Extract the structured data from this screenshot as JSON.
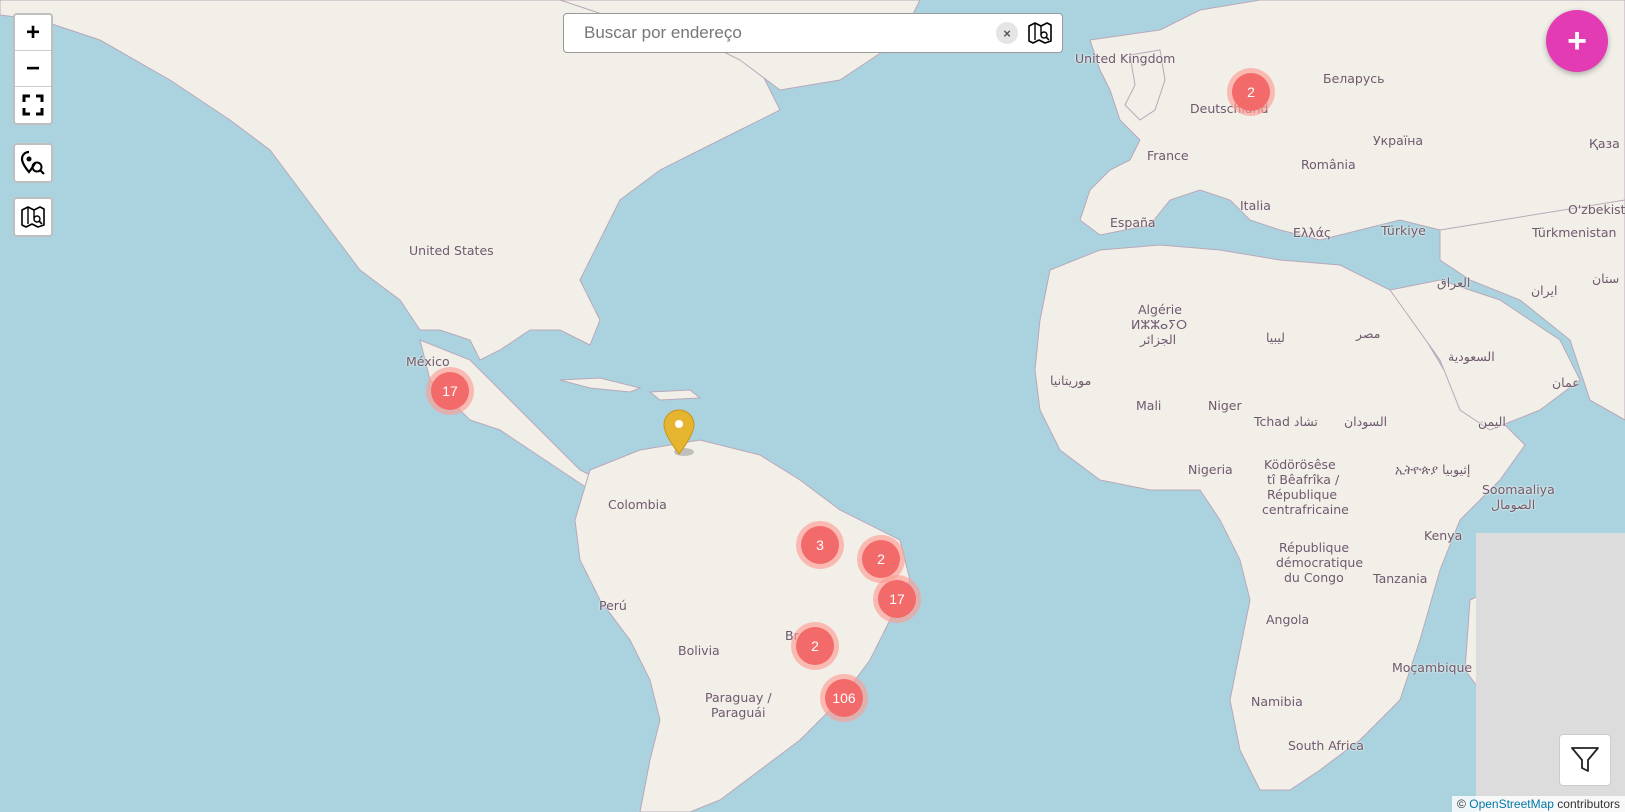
{
  "map": {
    "colors": {
      "water": "#aad3df",
      "land": "#f2efe9",
      "border": "#b9a8b9",
      "cluster_outer": "#fd9c94",
      "cluster_inner": "#f26a6a",
      "pin": "#e5b530",
      "fab": "#e23bb3"
    },
    "country_labels": [
      "United Kingdom",
      "Беларусь",
      "Deutschland",
      "Україна",
      "France",
      "România",
      "Қаза",
      "O'zbekist",
      "España",
      "Italia",
      "Ελλάς",
      "Türkiye",
      "Türkmenistan",
      "United States",
      "Algérie",
      "ⵍⵣⵣⴰⵢⵔ",
      "الجزائر",
      "ليبيا",
      "مصر",
      "العراق",
      "ايران",
      "ستان",
      "México",
      "موريتانيا",
      "Mali",
      "Niger",
      "Tchad تشاد",
      "السودان",
      "السعودية",
      "عمان",
      "اليمن",
      "Colombia",
      "Nigeria",
      "Ködörösêse",
      "tî Bêafrîka /",
      "République",
      "centrafricaine",
      "ኢትዮጵያ إثيوبيا",
      "Soomaaliya",
      "الصومال",
      "Kenya",
      "République",
      "démocratique",
      "du Congo",
      "Tanzania",
      "Perú",
      "Bolivia",
      "Br",
      "Angola",
      "Moçambique",
      "Paraguay /",
      "Paraguái",
      "Namibia",
      "South Africa"
    ]
  },
  "controls": {
    "zoom_in": "+",
    "zoom_out": "−",
    "fullscreen_icon": "fullscreen-icon",
    "locate_icon": "map-pin-search-icon",
    "layers_icon": "folded-map-icon"
  },
  "search": {
    "placeholder": "Buscar por endereço",
    "value": "",
    "clear_label": "×"
  },
  "fab": {
    "label": "+"
  },
  "clusters": [
    {
      "count": "2",
      "region": "Germany"
    },
    {
      "count": "17",
      "region": "Mexico"
    },
    {
      "count": "3",
      "region": "Brazil north"
    },
    {
      "count": "2",
      "region": "Brazil northeast"
    },
    {
      "count": "17",
      "region": "Brazil northeast coast"
    },
    {
      "count": "2",
      "region": "Brazil central"
    },
    {
      "count": "106",
      "region": "Brazil southeast"
    }
  ],
  "attribution": {
    "prefix": "©",
    "link": "OpenStreetMap",
    "suffix": "contributors"
  }
}
